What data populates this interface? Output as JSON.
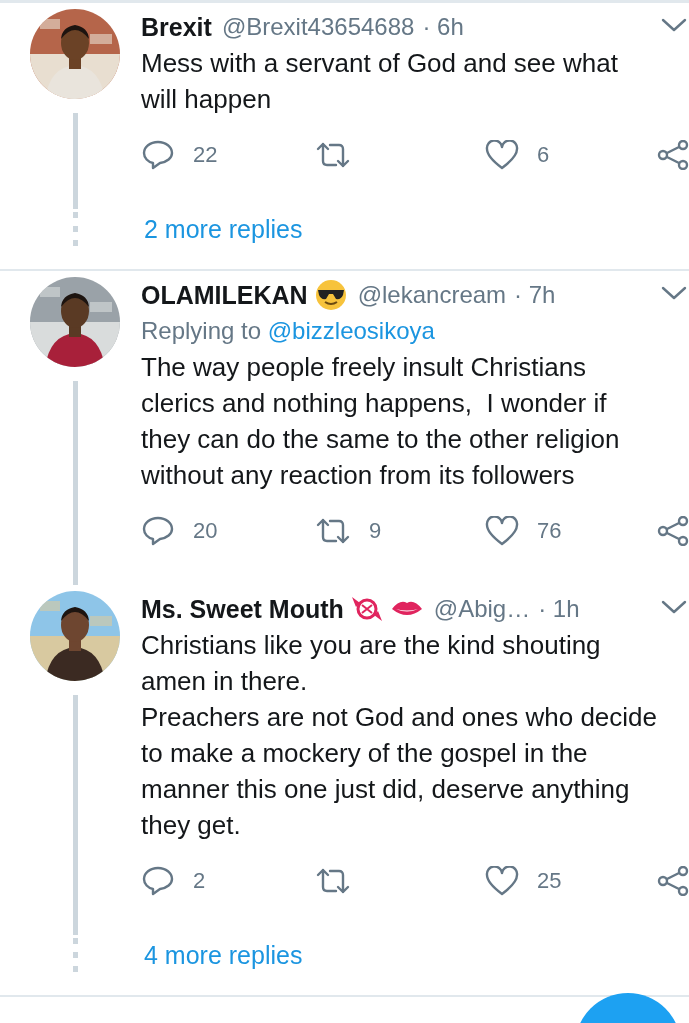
{
  "tweets": [
    {
      "name": "Brexit",
      "handle": "@Brexit43654688",
      "time": "· 6h",
      "text": "Mess with a servant of God and see what\nwill happen",
      "replies": "22",
      "likes": "6",
      "more_replies": "2 more replies"
    },
    {
      "name": "OLAMILEKAN",
      "badges": [
        {
          "kind": "sunglasses"
        }
      ],
      "handle": "@lekancream",
      "time": "· 7h",
      "replying_label": "Replying to",
      "replying_to": "@bizzleosikoya",
      "text": "The way people freely insult Christians\nclerics and nothing happens,  I wonder if\nthey can do the same to the other religion\nwithout any reaction from its followers",
      "replies": "20",
      "retweets": "9",
      "likes": "76"
    },
    {
      "name": "Ms. Sweet Mouth",
      "badges": [
        {
          "kind": "candy"
        },
        {
          "kind": "lips"
        }
      ],
      "handle": "@Abig…",
      "time": "· 1h",
      "text": "Christians like you are the kind shouting\namen in there.\nPreachers are not God and ones who decide\nto make a mockery of the gospel in the\nmanner this one just did, deserve anything\nthey get.",
      "replies": "2",
      "likes": "25",
      "more_replies": "4 more replies"
    }
  ]
}
